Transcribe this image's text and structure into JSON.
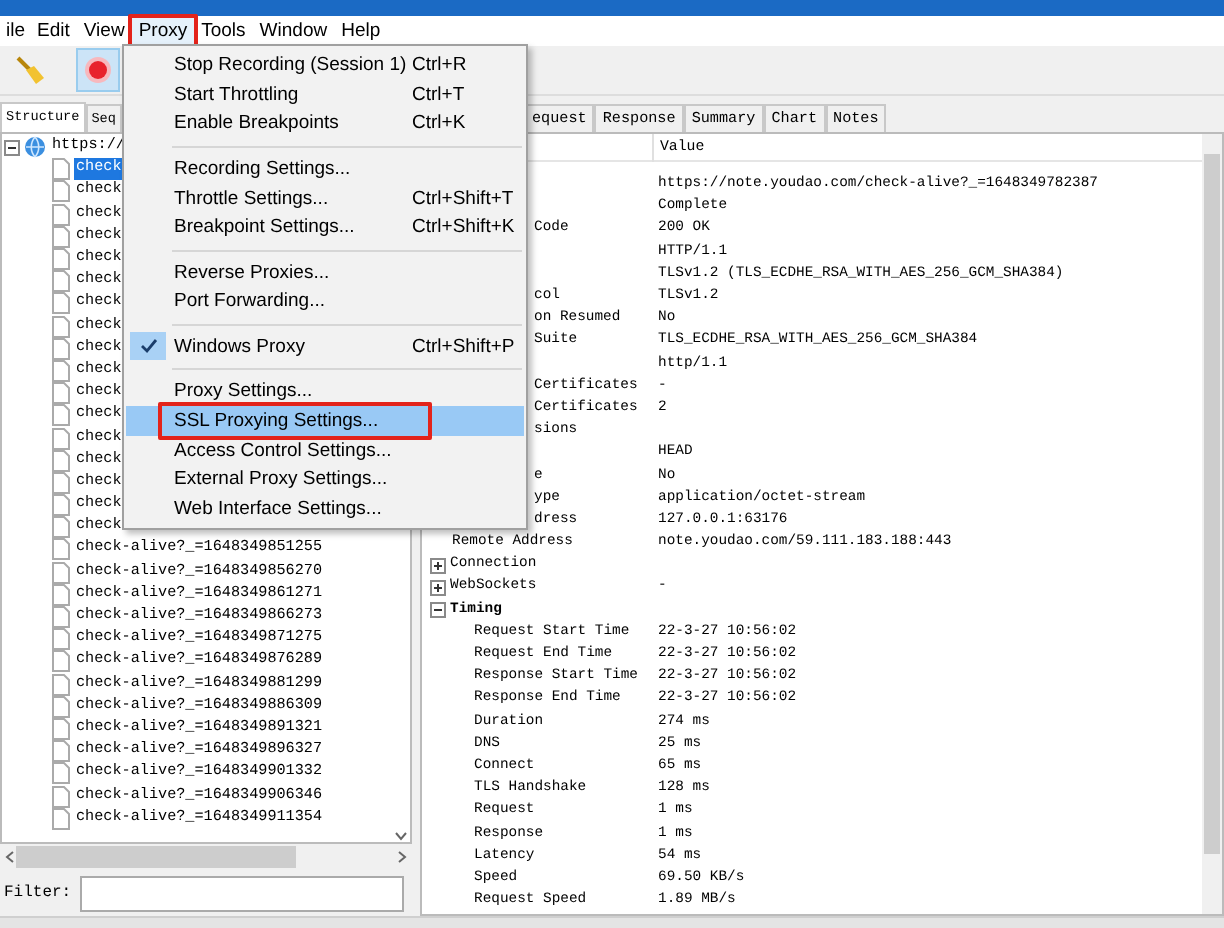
{
  "menu_bar": [
    {
      "label": "ile",
      "selected": false,
      "annotated": false
    },
    {
      "label": "Edit",
      "selected": false,
      "annotated": false
    },
    {
      "label": "View",
      "selected": false,
      "annotated": false
    },
    {
      "label": "Proxy",
      "selected": true,
      "annotated": true
    },
    {
      "label": "Tools",
      "selected": false,
      "annotated": false
    },
    {
      "label": "Window",
      "selected": false,
      "annotated": false
    },
    {
      "label": "Help",
      "selected": false,
      "annotated": false
    }
  ],
  "toolbar": [
    {
      "kind": "broom",
      "selected": false
    },
    {
      "kind": "record",
      "selected": true
    }
  ],
  "proxy_menu": [
    {
      "kind": "item",
      "label": "Stop Recording (Session 1)",
      "shortcut": "Ctrl+R",
      "checked": false,
      "selected": false,
      "annotated": false
    },
    {
      "kind": "item",
      "label": "Start Throttling",
      "shortcut": "Ctrl+T",
      "checked": false,
      "selected": false,
      "annotated": false
    },
    {
      "kind": "item",
      "label": "Enable Breakpoints",
      "shortcut": "Ctrl+K",
      "checked": false,
      "selected": false,
      "annotated": false
    },
    {
      "kind": "separator"
    },
    {
      "kind": "item",
      "label": "Recording Settings...",
      "checked": false,
      "selected": false,
      "annotated": false
    },
    {
      "kind": "item",
      "label": "Throttle Settings...",
      "shortcut": "Ctrl+Shift+T",
      "checked": false,
      "selected": false,
      "annotated": false
    },
    {
      "kind": "item",
      "label": "Breakpoint Settings...",
      "shortcut": "Ctrl+Shift+K",
      "checked": false,
      "selected": false,
      "annotated": false
    },
    {
      "kind": "separator"
    },
    {
      "kind": "item",
      "label": "Reverse Proxies...",
      "checked": false,
      "selected": false,
      "annotated": false
    },
    {
      "kind": "item",
      "label": "Port Forwarding...",
      "checked": false,
      "selected": false,
      "annotated": false
    },
    {
      "kind": "separator"
    },
    {
      "kind": "item",
      "label": "Windows Proxy",
      "shortcut": "Ctrl+Shift+P",
      "checked": true,
      "selected": false,
      "annotated": false
    },
    {
      "kind": "separator"
    },
    {
      "kind": "item",
      "label": "Proxy Settings...",
      "checked": false,
      "selected": false,
      "annotated": false
    },
    {
      "kind": "item",
      "label": "SSL Proxying Settings...",
      "checked": false,
      "selected": true,
      "annotated": true
    },
    {
      "kind": "item",
      "label": "Access Control Settings...",
      "checked": false,
      "selected": false,
      "annotated": false
    },
    {
      "kind": "item",
      "label": "External Proxy Settings...",
      "checked": false,
      "selected": false,
      "annotated": false
    },
    {
      "kind": "item",
      "label": "Web Interface Settings...",
      "checked": false,
      "selected": false,
      "annotated": false
    }
  ],
  "left_tabs": [
    {
      "label": "Structure",
      "selected": true
    },
    {
      "label": "Seq",
      "selected": false
    }
  ],
  "tree": {
    "label": "https://",
    "expanded": true,
    "children": [
      {
        "label": "check",
        "selected": true
      },
      {
        "label": "check",
        "selected": false
      },
      {
        "label": "check",
        "selected": false
      },
      {
        "label": "check",
        "selected": false
      },
      {
        "label": "check",
        "selected": false
      },
      {
        "label": "check",
        "selected": false
      },
      {
        "label": "check",
        "selected": false
      },
      {
        "label": "check",
        "selected": false
      },
      {
        "label": "check",
        "selected": false
      },
      {
        "label": "check",
        "selected": false
      },
      {
        "label": "check",
        "selected": false
      },
      {
        "label": "check",
        "selected": false
      },
      {
        "label": "check",
        "selected": false
      },
      {
        "label": "check",
        "selected": false
      },
      {
        "label": "check",
        "selected": false
      },
      {
        "label": "check",
        "selected": false
      },
      {
        "label": "check",
        "selected": false
      },
      {
        "label": "check-alive?_=1648349851255",
        "selected": false
      },
      {
        "label": "check-alive?_=1648349856270",
        "selected": false
      },
      {
        "label": "check-alive?_=1648349861271",
        "selected": false
      },
      {
        "label": "check-alive?_=1648349866273",
        "selected": false
      },
      {
        "label": "check-alive?_=1648349871275",
        "selected": false
      },
      {
        "label": "check-alive?_=1648349876289",
        "selected": false
      },
      {
        "label": "check-alive?_=1648349881299",
        "selected": false
      },
      {
        "label": "check-alive?_=1648349886309",
        "selected": false
      },
      {
        "label": "check-alive?_=1648349891321",
        "selected": false
      },
      {
        "label": "check-alive?_=1648349896327",
        "selected": false
      },
      {
        "label": "check-alive?_=1648349901332",
        "selected": false
      },
      {
        "label": "check-alive?_=1648349906346",
        "selected": false
      },
      {
        "label": "check-alive?_=1648349911354",
        "selected": false
      }
    ]
  },
  "filter": {
    "label": "Filter:"
  },
  "right_tabs": [
    {
      "label": "equest",
      "selected": false
    },
    {
      "label": "Response",
      "selected": false
    },
    {
      "label": "Summary",
      "selected": false
    },
    {
      "label": "Chart",
      "selected": false
    },
    {
      "label": "Notes",
      "selected": false
    }
  ],
  "overview": {
    "column_2": "Value",
    "rows": [
      {
        "kind": "row",
        "value": "https://note.youdao.com/check-alive?_=1648349782387"
      },
      {
        "kind": "row",
        "value": "Complete"
      },
      {
        "kind": "row",
        "label": "Code",
        "covered": true,
        "value": "200 OK"
      },
      {
        "kind": "row",
        "value": "HTTP/1.1"
      },
      {
        "kind": "row",
        "value": "TLSv1.2 (TLS_ECDHE_RSA_WITH_AES_256_GCM_SHA384)"
      },
      {
        "kind": "row",
        "label": "col",
        "covered": true,
        "value": "TLSv1.2"
      },
      {
        "kind": "row",
        "label": "on Resumed",
        "covered": true,
        "value": "No"
      },
      {
        "kind": "row",
        "label": "Suite",
        "covered": true,
        "value": "TLS_ECDHE_RSA_WITH_AES_256_GCM_SHA384"
      },
      {
        "kind": "row",
        "value": "http/1.1"
      },
      {
        "kind": "row",
        "label": "Certificates",
        "covered": true,
        "value": "-"
      },
      {
        "kind": "row",
        "label": "Certificates",
        "covered": true,
        "value": "2"
      },
      {
        "kind": "row",
        "label": "sions",
        "covered": true
      },
      {
        "kind": "row",
        "value": "HEAD"
      },
      {
        "kind": "row",
        "label": "e",
        "covered": true,
        "value": "No"
      },
      {
        "kind": "row",
        "label": "ype",
        "covered": true,
        "value": "application/octet-stream"
      },
      {
        "kind": "row",
        "label": "dress",
        "covered": true,
        "value": "127.0.0.1:63176"
      },
      {
        "kind": "row",
        "label": "Remote Address",
        "covered": false,
        "value": "note.youdao.com/59.111.183.188:443"
      },
      {
        "kind": "group",
        "label": "Connection",
        "expanded": false
      },
      {
        "kind": "group",
        "label": "WebSockets",
        "expanded": false,
        "value": "-"
      },
      {
        "kind": "group",
        "label": "Timing",
        "expanded": true,
        "children": [
          {
            "label": "Request Start Time",
            "value": "22-3-27 10:56:02"
          },
          {
            "label": "Request End Time",
            "value": "22-3-27 10:56:02"
          },
          {
            "label": "Response Start Time",
            "value": "22-3-27 10:56:02"
          },
          {
            "label": "Response End Time",
            "value": "22-3-27 10:56:02"
          },
          {
            "label": "Duration",
            "value": "274 ms"
          },
          {
            "label": "DNS",
            "value": "25 ms"
          },
          {
            "label": "Connect",
            "value": "65 ms"
          },
          {
            "label": "TLS Handshake",
            "value": "128 ms"
          },
          {
            "label": "Request",
            "value": "1 ms"
          },
          {
            "label": "Response",
            "value": "1 ms"
          },
          {
            "label": "Latency",
            "value": "54 ms"
          },
          {
            "label": "Speed",
            "value": "69.50 KB/s"
          },
          {
            "label": "Request Speed",
            "value": "1.89 MB/s"
          }
        ]
      }
    ]
  }
}
